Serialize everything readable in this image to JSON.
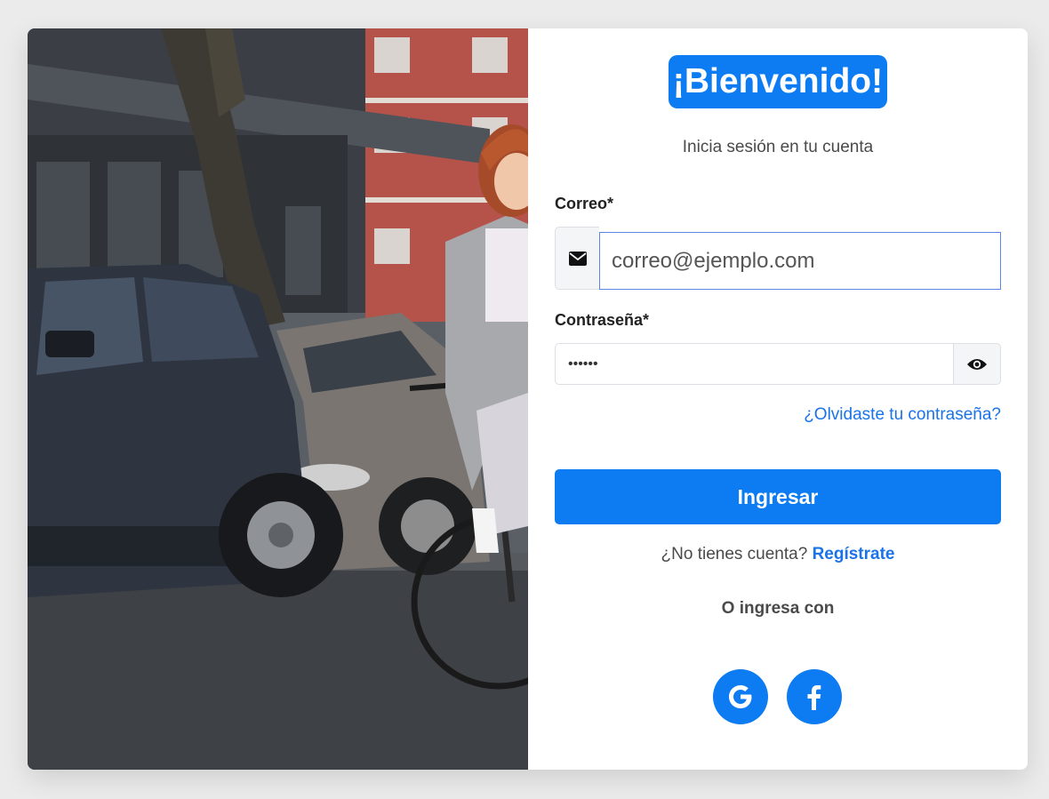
{
  "login": {
    "title": "¡Bienvenido!",
    "subtitle": "Inicia sesión en tu cuenta",
    "email_label": "Correo*",
    "email_value": "correo@ejemplo.com",
    "password_label": "Contraseña*",
    "password_value": "••••••",
    "forgot_link": "¿Olvidaste tu contraseña?",
    "submit_label": "Ingresar",
    "no_account_text": "¿No tienes cuenta?",
    "register_link": "Regístrate",
    "social_text": "O ingresa con"
  },
  "icons": {
    "email": "envelope-icon",
    "password_toggle": "eye-icon",
    "google": "google-icon",
    "facebook": "facebook-icon"
  },
  "colors": {
    "primary": "#0d7cf2",
    "link": "#1a73e8",
    "background": "#ebebeb"
  }
}
